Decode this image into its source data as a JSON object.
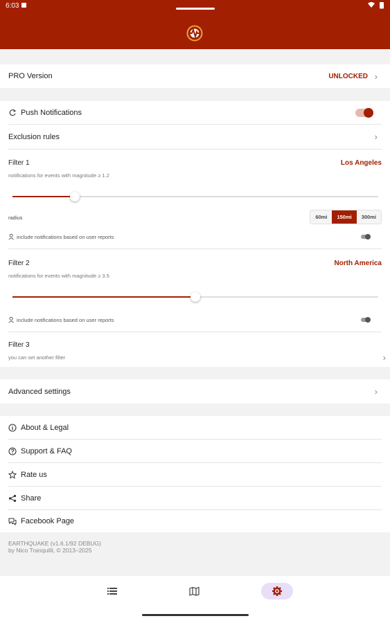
{
  "status": {
    "time": "6:03"
  },
  "pro": {
    "label": "PRO Version",
    "value": "UNLOCKED"
  },
  "push": {
    "label": "Push Notifications",
    "enabled": true
  },
  "exclusion": {
    "label": "Exclusion rules"
  },
  "filter1": {
    "title": "Filter 1",
    "location": "Los Angeles",
    "subtitle": "notifications for events with magnitude ≥ 1.2",
    "slider_level_percent": 17,
    "radius_label": "radius",
    "radius_options": [
      "60mi",
      "150mi",
      "300mi"
    ],
    "radius_selected": "150mi",
    "user_reports_label": "include notifications based on user reports",
    "user_reports_enabled": false
  },
  "filter2": {
    "title": "Filter 2",
    "location": "North America",
    "subtitle": "notifications for events with magnitude ≥ 3.5",
    "slider_level_percent": 50,
    "user_reports_label": "include notifications based on user reports",
    "user_reports_enabled": false
  },
  "filter3": {
    "title": "Filter 3",
    "subtitle": "you can set another filter"
  },
  "advanced": {
    "label": "Advanced settings"
  },
  "links": [
    {
      "label": "About & Legal",
      "icon": "info-icon"
    },
    {
      "label": "Support & FAQ",
      "icon": "help-icon"
    },
    {
      "label": "Rate us",
      "icon": "star-icon"
    },
    {
      "label": "Share",
      "icon": "share-icon"
    },
    {
      "label": "Facebook Page",
      "icon": "chat-icon"
    }
  ],
  "footer": {
    "version": "EARTHQUAKE (v1.6.1/92 DEBUG)",
    "copyright": "by Nico Tranquilli, © 2013–2025"
  },
  "nav": {
    "active": "settings",
    "items": [
      "list",
      "map",
      "settings"
    ]
  },
  "colors": {
    "accent": "#a21f02",
    "nav_active_bg": "#e8def8"
  }
}
